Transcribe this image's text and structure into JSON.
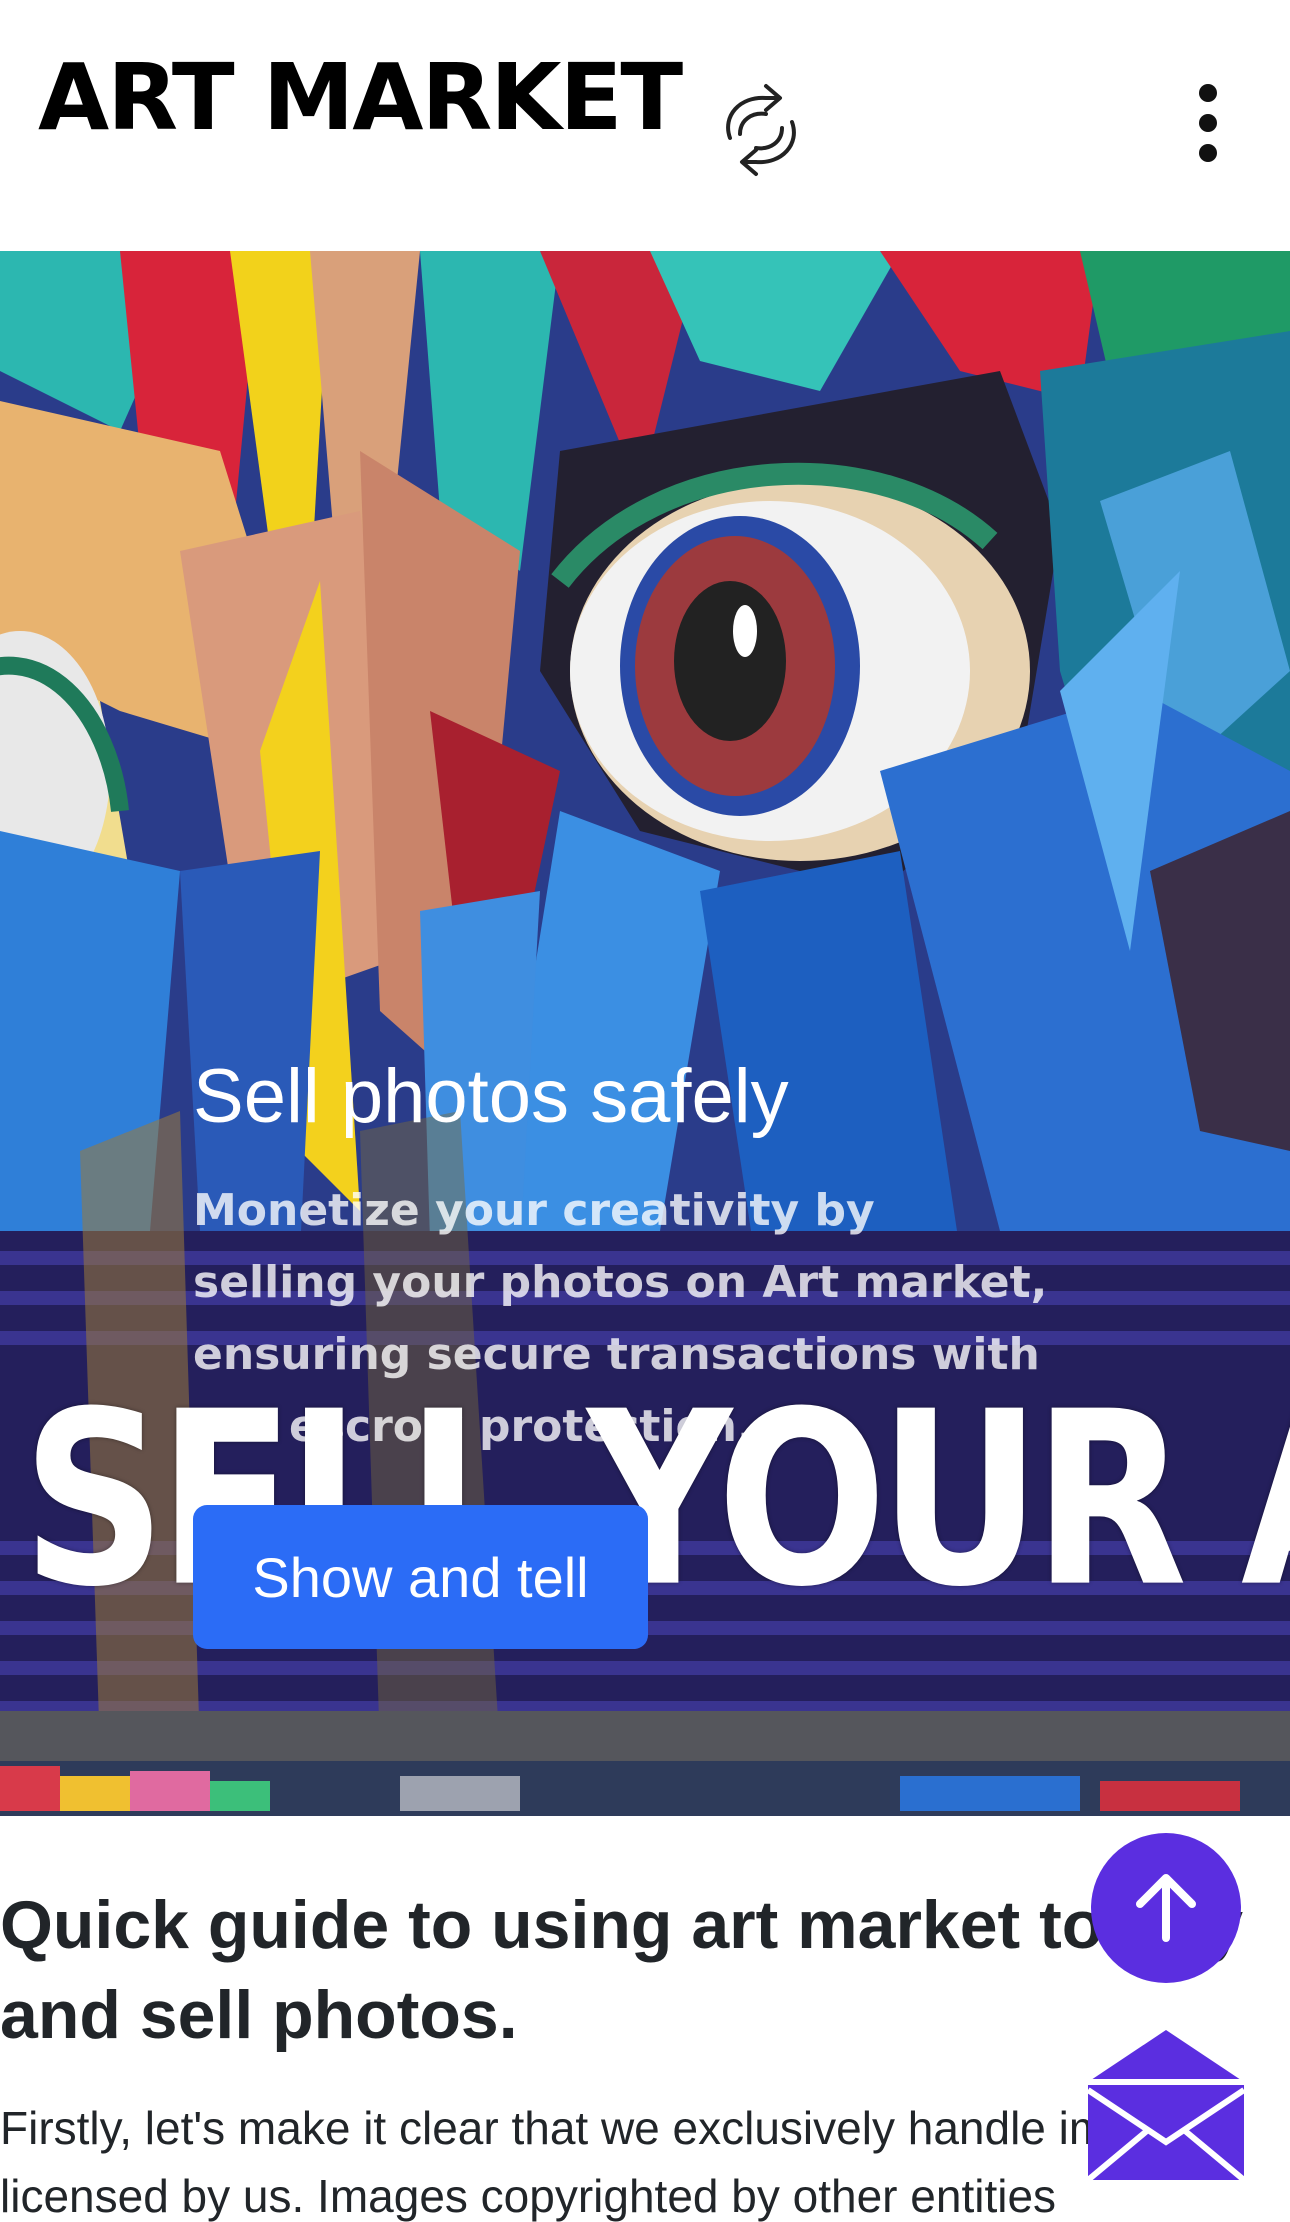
{
  "header": {
    "brand": "ART MARKET",
    "sync_icon": "sync-icon",
    "menu_icon": "kebab-menu-icon"
  },
  "hero": {
    "title": "Sell photos safely",
    "text": "Monetize your creativity by selling your photos on Art market, ensuring secure transactions with full escrow protection.",
    "banner_text": "SELL YOUR ART ONLINE",
    "cta_label": "Show and tell"
  },
  "guide": {
    "title": "Quick guide to using art market to buy and sell photos.",
    "body": "Firstly, let's make it clear that we exclusively handle images licensed by us. Images copyrighted by other entities"
  },
  "fabs": {
    "scroll_top_icon": "arrow-up-icon",
    "mail_icon": "mail-icon"
  },
  "colors": {
    "accent_blue": "#2b6cf6",
    "fab_purple": "#5b2ee0"
  }
}
